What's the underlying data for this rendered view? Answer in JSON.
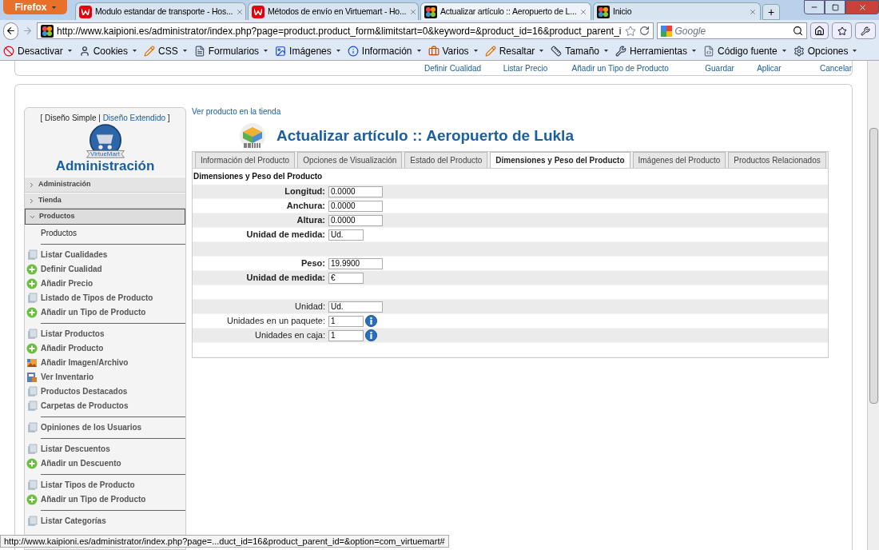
{
  "browser": {
    "menu_button": "Firefox",
    "tabs": [
      {
        "title": "Modulo estandar de transporte - Hos...",
        "kind": "w",
        "selected": false
      },
      {
        "title": "Métodos de envío en Virtuemart - Ho...",
        "kind": "w",
        "selected": false
      },
      {
        "title": "Actualizar artículo :: Aeropuerto de L...",
        "kind": "joomla",
        "selected": true
      },
      {
        "title": "Inicio",
        "kind": "joomla",
        "selected": false
      }
    ],
    "new_tab": "+",
    "address": "http://www.kaipioni.es/administrator/index.php?page=product.product_form&limitstart=0&keyword=&product_id=16&product_parent_i",
    "search_placeholder": "Google",
    "toolbar": [
      {
        "label": "Desactivar",
        "kind": "ban"
      },
      {
        "label": "Cookies",
        "kind": "user"
      },
      {
        "label": "CSS",
        "kind": "pencil"
      },
      {
        "label": "Formularios",
        "kind": "form"
      },
      {
        "label": "Imágenes",
        "kind": "image"
      },
      {
        "label": "Información",
        "kind": "info"
      },
      {
        "label": "Varios",
        "kind": "case"
      },
      {
        "label": "Resaltar",
        "kind": "pencil"
      },
      {
        "label": "Tamaño",
        "kind": "ruler"
      },
      {
        "label": "Herramientas",
        "kind": "wrench"
      },
      {
        "label": "Código fuente",
        "kind": "file"
      },
      {
        "label": "Opciones",
        "kind": "settings"
      }
    ],
    "status": "http://www.kaipioni.es/administrator/index.php?page=...duct_id=16&product_parent_id=&option=com_virtuemart#"
  },
  "top_links": [
    "Definir Cualidad",
    "Listar Precio",
    "Añadir un Tipo de Producto"
  ],
  "actions": [
    "Guardar",
    "Aplicar",
    "Cancelar"
  ],
  "sidebar": {
    "layout_open": "[ ",
    "layouts": [
      {
        "label": "Diseño Simple",
        "selected": true
      },
      {
        "label": "Diseño Extendido",
        "selected": false
      }
    ],
    "layout_sep": " | ",
    "layout_close": " ]",
    "logo_text": "VirtueMart",
    "title": "Administración",
    "sections": [
      {
        "label": "Administración",
        "expanded": false
      },
      {
        "label": "Tienda",
        "expanded": false
      },
      {
        "label": "Productos",
        "expanded": true
      }
    ],
    "subheading": "Productos",
    "groups": [
      [
        {
          "label": "Listar Cualidades",
          "kind": "list"
        },
        {
          "label": "Definir Cualidad",
          "kind": "add"
        },
        {
          "label": "Añadir Precio",
          "kind": "add"
        },
        {
          "label": "Listado de Tipos de Producto",
          "kind": "list"
        },
        {
          "label": "Añadir un Tipo de Producto",
          "kind": "add"
        }
      ],
      [
        {
          "label": "Listar Productos",
          "kind": "list"
        },
        {
          "label": "Añadir Producto",
          "kind": "add"
        },
        {
          "label": "Añadir Imagen/Archivo",
          "kind": "image"
        },
        {
          "label": "Ver Inventario",
          "kind": "inventory"
        },
        {
          "label": "Productos Destacados",
          "kind": "list"
        },
        {
          "label": "Carpetas de Productos",
          "kind": "list"
        }
      ],
      [
        {
          "label": "Opiniones de los Usuarios",
          "kind": "list"
        }
      ],
      [
        {
          "label": "Listar Descuentos",
          "kind": "list"
        },
        {
          "label": "Añadir un Descuento",
          "kind": "add"
        }
      ],
      [
        {
          "label": "Listar Tipos de Producto",
          "kind": "list"
        },
        {
          "label": "Añadir un Tipo de Producto",
          "kind": "add"
        }
      ],
      [
        {
          "label": "Listar Categorías",
          "kind": "list"
        }
      ]
    ]
  },
  "content": {
    "store_link": "Ver producto en la tienda",
    "title": "Actualizar artículo :: Aeropuerto de Lukla",
    "tabs": [
      {
        "label": "Información del Producto",
        "selected": false
      },
      {
        "label": "Opciones de Visualización",
        "selected": false
      },
      {
        "label": "Estado del Producto",
        "selected": false
      },
      {
        "label": "Dimensiones y Peso del Producto",
        "selected": true
      },
      {
        "label": "Imágenes del Producto",
        "selected": false
      },
      {
        "label": "Productos Relacionados",
        "selected": false
      }
    ],
    "section_title": "Dimensiones y Peso del Producto",
    "rows": [
      {
        "kind": "dimension",
        "label": "Longitud:",
        "value": "0.0000"
      },
      {
        "kind": "dimension",
        "label": "Anchura:",
        "value": "0.0000"
      },
      {
        "kind": "dimension",
        "label": "Altura:",
        "value": "0.0000"
      },
      {
        "kind": "unit",
        "label": "Unidad de medida:",
        "value": "Ud."
      },
      {
        "kind": "spacer"
      },
      {
        "kind": "dimension",
        "label": "Peso:",
        "value": "19.9900"
      },
      {
        "kind": "unit",
        "label": "Unidad de medida:",
        "value": "€"
      },
      {
        "kind": "spacer"
      },
      {
        "kind": "quantity",
        "label": "Unidad:",
        "value": "Ud."
      },
      {
        "kind": "quantity_info",
        "label": "Unidades en un paquete:",
        "value": "1"
      },
      {
        "kind": "quantity_info",
        "label": "Unidades en caja:",
        "value": "1"
      },
      {
        "kind": "spacer"
      }
    ]
  }
}
